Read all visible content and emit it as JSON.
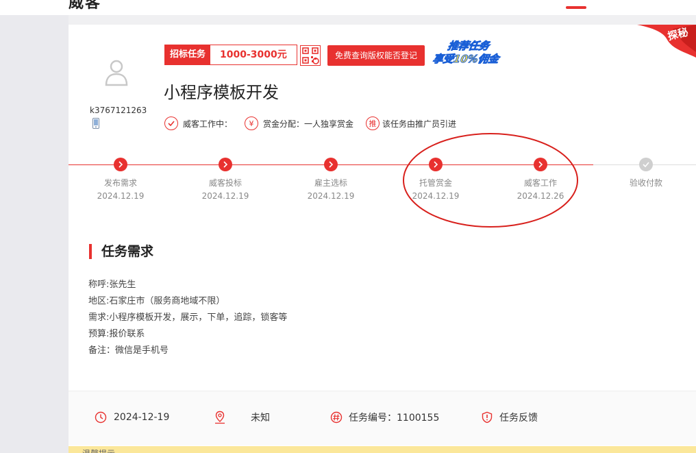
{
  "header": {
    "logo_fragment": "威客"
  },
  "profile": {
    "username": "k3767121263",
    "avatar_icon": "user-icon",
    "phone_icon": "mobile-icon"
  },
  "task": {
    "tag_label": "招标任务",
    "amount": "1000-3000元",
    "qr_icon": "qr-code-icon",
    "check_button": "免费查询版权能否登记",
    "promo_line1": "推荐任务",
    "promo_line2_a": "享受",
    "promo_line2_b": "10%佣金",
    "corner_label": "探秘",
    "title": "小程序模板开发"
  },
  "meta": {
    "status": "威客工作中：",
    "reward_split": "赏金分配：一人独享赏金",
    "promoter_badge": "推",
    "promoter_text": "该任务由推广员引进",
    "yuan_symbol": "¥"
  },
  "steps": [
    {
      "name": "发布需求",
      "date": "2024.12.19",
      "done": true
    },
    {
      "name": "威客投标",
      "date": "2024.12.19",
      "done": true
    },
    {
      "name": "雇主选标",
      "date": "2024.12.19",
      "done": true
    },
    {
      "name": "托管赏金",
      "date": "2024.12.19",
      "done": true
    },
    {
      "name": "威客工作",
      "date": "2024.12.26",
      "done": true
    },
    {
      "name": "验收付款",
      "date": "",
      "done": false
    }
  ],
  "requirements": {
    "section_title": "任务需求",
    "lines": [
      "称呼:张先生",
      "地区:石家庄市（服务商地域不限）",
      "需求:小程序模板开发，展示，下单，追踪，锁客等",
      "预算:报价联系",
      "备注：微信是手机号"
    ]
  },
  "footer": {
    "date": "2024-12-19",
    "location": "未知",
    "task_number": "任务编号：1100155",
    "feedback": "任务反馈",
    "notice_fragment": "温馨提示"
  },
  "colors": {
    "accent": "#e8312f",
    "annotation": "#d8201c",
    "promo_blue": "#1a5fd6",
    "promo_yellow": "#ffe14d",
    "notice_bg": "#fbe79a"
  }
}
